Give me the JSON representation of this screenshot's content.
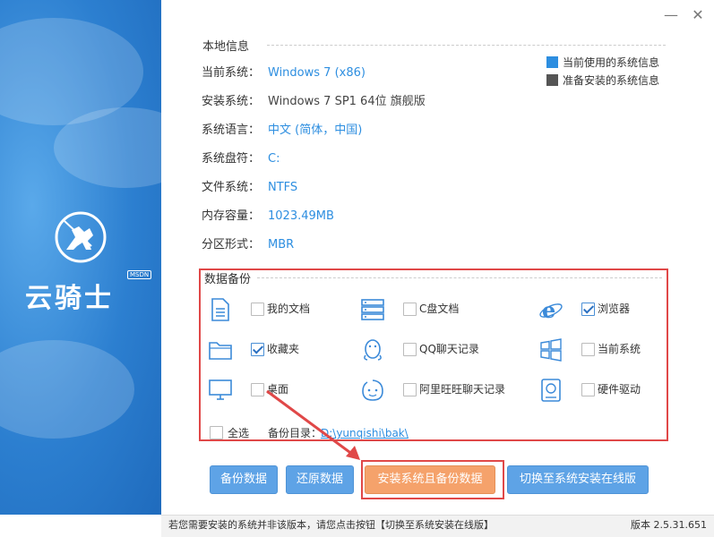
{
  "window": {
    "minimize_glyph": "—",
    "close_glyph": "✕"
  },
  "brand": {
    "name": "云骑士",
    "badge": "MSDN"
  },
  "local_info": {
    "title": "本地信息",
    "rows": [
      {
        "label": "当前系统：",
        "value": "Windows 7 (x86)",
        "highlight": true
      },
      {
        "label": "安装系统：",
        "value": "Windows 7 SP1 64位 旗舰版",
        "highlight": false
      },
      {
        "label": "系统语言：",
        "value": "中文 (简体，中国)",
        "highlight": true
      },
      {
        "label": "系统盘符：",
        "value": "C:",
        "highlight": true
      },
      {
        "label": "文件系统：",
        "value": "NTFS",
        "highlight": true
      },
      {
        "label": "内存容量：",
        "value": "1023.49MB",
        "highlight": true
      },
      {
        "label": "分区形式：",
        "value": "MBR",
        "highlight": true
      }
    ]
  },
  "legend": {
    "current_label": "当前使用的系统信息",
    "current_color": "#2d8ee0",
    "target_label": "准备安装的系统信息",
    "target_color": "#555555"
  },
  "backup": {
    "title": "数据备份",
    "items": [
      {
        "label": "我的文档",
        "checked": false,
        "icon": "document-icon"
      },
      {
        "label": "C盘文档",
        "checked": false,
        "icon": "server-icon"
      },
      {
        "label": "浏览器",
        "checked": true,
        "icon": "ie-browser-icon"
      },
      {
        "label": "收藏夹",
        "checked": true,
        "icon": "folder-icon"
      },
      {
        "label": "QQ聊天记录",
        "checked": false,
        "icon": "qq-penguin-icon"
      },
      {
        "label": "当前系统",
        "checked": false,
        "icon": "windows-icon"
      },
      {
        "label": "桌面",
        "checked": false,
        "icon": "monitor-icon"
      },
      {
        "label": "阿里旺旺聊天记录",
        "checked": false,
        "icon": "wangwang-icon"
      },
      {
        "label": "硬件驱动",
        "checked": false,
        "icon": "hardware-icon"
      }
    ],
    "select_all_label": "全选",
    "dir_label": "备份目录：",
    "dir_value": "D:\\yunqishi\\bak\\"
  },
  "buttons": {
    "backup": "备份数据",
    "restore": "还原数据",
    "install_backup": "安装系统且备份数据",
    "switch_online": "切换至系统安装在线版"
  },
  "footer": {
    "hint": "若您需要安装的系统并非该版本，请您点击按钮【切换至系统安装在线版】",
    "version": "版本 2.5.31.651"
  }
}
